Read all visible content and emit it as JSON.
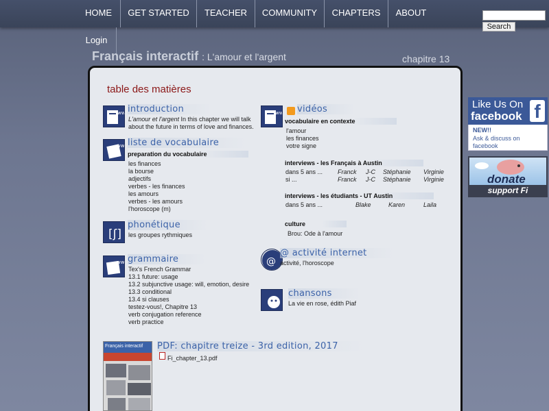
{
  "nav": {
    "items": [
      "HOME",
      "GET STARTED",
      "TEACHER",
      "COMMUNITY",
      "CHAPTERS",
      "ABOUT"
    ],
    "login": "Login",
    "search_button": "Search"
  },
  "header": {
    "title": "Français interactif",
    "subtitle": ": L'amour et l'argent",
    "chapter": "chapitre 13"
  },
  "toc_title": "table des matières",
  "left": {
    "introduction": {
      "heading": "introduction",
      "text_italic": "L'amour et l'argent",
      "text_line1": " In this chapter we will talk",
      "text_line2": "about the future in terms of love and finances."
    },
    "vocab": {
      "heading": "liste de vocabulaire",
      "subheading": "preparation du vocabulaire",
      "items": [
        "les finances",
        "la bourse",
        "adjectifs",
        "verbes - les finances",
        "les amours",
        "verbes - les amours",
        "l'horoscope (m)"
      ]
    },
    "phonetique": {
      "heading": "phonétique",
      "items": [
        "les groupes rythmiques"
      ]
    },
    "grammaire": {
      "heading": "grammaire",
      "items": [
        "Tex's French Grammar",
        "13.1  future: usage",
        "13.2  subjunctive usage: will, emotion, desire",
        "13.3  conditional",
        "13.4  si clauses",
        "testez-vous!, Chapitre 13",
        "verb conjugation reference",
        "verb practice"
      ]
    },
    "pdf": {
      "heading": "PDF: chapitre treize - 3rd edition, 2017",
      "file": "Fi_chapter_13.pdf",
      "cover_title": "Français interactif"
    }
  },
  "right": {
    "videos": {
      "heading": "vidéos",
      "context_head": "vocabulaire en contexte",
      "context_items": [
        "l'amour",
        "les finances",
        "votre signe"
      ],
      "int1_head": "interviews - les Français à Austin",
      "int1_rows": [
        [
          "dans 5 ans ...",
          "Franck",
          "J-C",
          "Stéphanie",
          "Virginie"
        ],
        [
          "si ...",
          "Franck",
          "J-C",
          "Stéphanie",
          "Virginie"
        ]
      ],
      "int2_head": "interviews - les étudiants - UT Austin",
      "int2_rows": [
        [
          "dans 5 ans ...",
          "Blake",
          "Karen",
          "Laila"
        ]
      ],
      "culture_head": "culture",
      "culture_items": [
        "Brou: Ode à l'amour"
      ]
    },
    "internet": {
      "heading": "@ activité internet",
      "items": [
        "activité, l'horoscope"
      ]
    },
    "chansons": {
      "heading": "chansons",
      "items": [
        "La vie en rose, édith Piaf"
      ]
    }
  },
  "sidebar": {
    "fb_like": "Like Us On",
    "fb_word": "facebook",
    "fb_f": "f",
    "fb_new": "NEW!!",
    "fb_ask": "Ask & discuss on facebook",
    "donate_word": "donate",
    "donate_support": "support Fi"
  },
  "colors": {
    "heading_blue": "#3b62a8",
    "toc_red": "#8b1717",
    "facebook": "#3b5998"
  }
}
